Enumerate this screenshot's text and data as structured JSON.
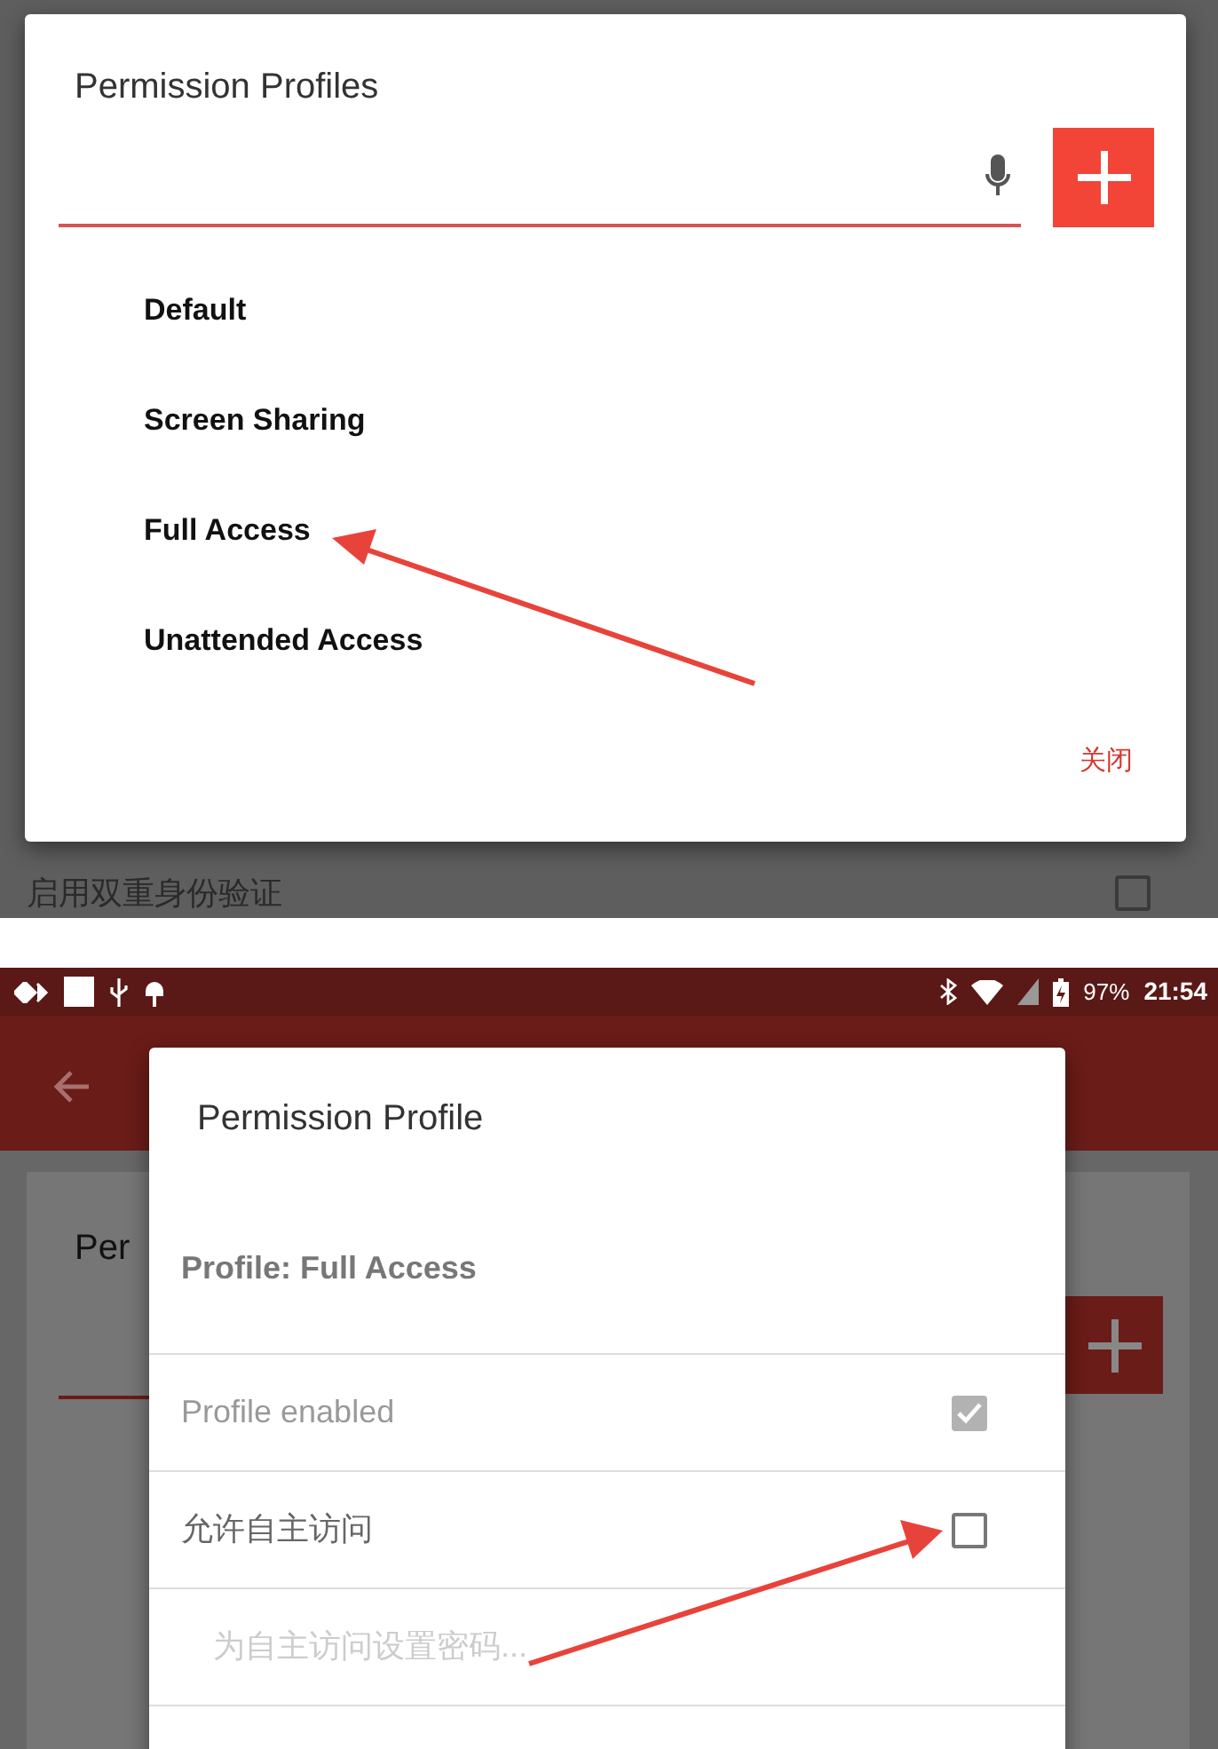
{
  "profiles_dialog": {
    "title": "Permission Profiles",
    "profiles": [
      {
        "label": "Default"
      },
      {
        "label": "Screen Sharing"
      },
      {
        "label": "Full Access"
      },
      {
        "label": "Unattended Access"
      }
    ],
    "close_button": "关闭"
  },
  "background_setting": {
    "label": "启用双重身份验证",
    "checked": false
  },
  "status_bar": {
    "battery": "97%",
    "time": "21:54"
  },
  "background_card_title": "Per",
  "profile_dialog": {
    "title": "Permission Profile",
    "subtitle": "Profile: Full Access",
    "rows": [
      {
        "kind": "checkbox",
        "label": "Profile enabled",
        "checked": true,
        "disabled": true
      },
      {
        "kind": "checkbox",
        "label": "允许自主访问",
        "checked": false,
        "disabled": false
      },
      {
        "kind": "field",
        "placeholder": "为自主访问设置密码..."
      }
    ]
  }
}
